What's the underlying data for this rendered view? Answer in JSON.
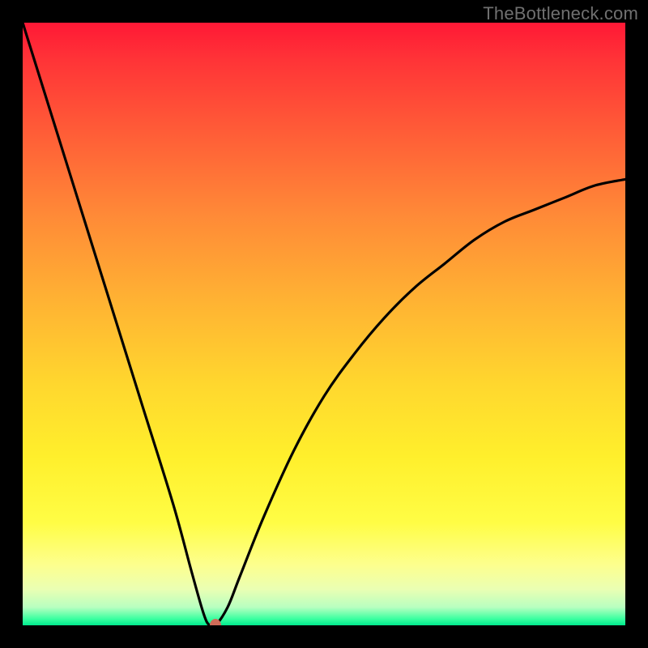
{
  "watermark": "TheBottleneck.com",
  "chart_data": {
    "type": "line",
    "title": "",
    "xlabel": "",
    "ylabel": "",
    "xlim": [
      0,
      100
    ],
    "ylim": [
      0,
      100
    ],
    "grid": false,
    "legend": false,
    "background": "red-yellow-green vertical gradient (red top, green bottom)",
    "series": [
      {
        "name": "bottleneck-curve",
        "x": [
          0,
          5,
          10,
          15,
          20,
          25,
          28,
          30,
          31,
          32,
          34,
          36,
          40,
          45,
          50,
          55,
          60,
          65,
          70,
          75,
          80,
          85,
          90,
          95,
          100
        ],
        "values": [
          100,
          84,
          68,
          52,
          36,
          20,
          9,
          2,
          0,
          0,
          3,
          8,
          18,
          29,
          38,
          45,
          51,
          56,
          60,
          64,
          67,
          69,
          71,
          73,
          74
        ]
      }
    ],
    "marker": {
      "x": 32,
      "y": 0,
      "color": "#cf6b58"
    }
  },
  "colors": {
    "frame": "#000000",
    "curve": "#000000",
    "watermark": "#707070"
  }
}
